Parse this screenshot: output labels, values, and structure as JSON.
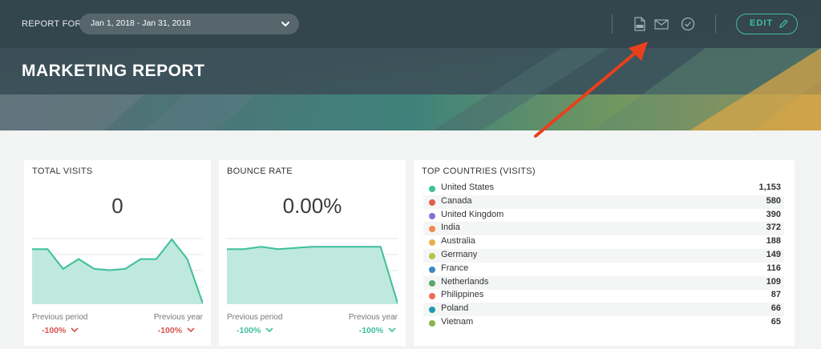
{
  "header": {
    "report_for_label": "REPORT FOR",
    "date_range": "Jan 1, 2018 - Jan 31, 2018",
    "title": "MARKETING REPORT",
    "edit_label": "EDIT",
    "icons": [
      "pdf-icon",
      "email-icon",
      "check-circle-icon",
      "pencil-icon",
      "chevron-down-icon"
    ]
  },
  "colors": {
    "accent": "#3dbf9c",
    "negative": "#d9534f",
    "annotation_arrow": "#e8401c"
  },
  "total_visits": {
    "title": "TOTAL VISITS",
    "value": "0",
    "prev_period_label": "Previous period",
    "prev_period_value": "-100%",
    "prev_year_label": "Previous year",
    "prev_year_value": "-100%",
    "sparkline": [
      10,
      10,
      2,
      6,
      2,
      1.5,
      2,
      6,
      6,
      14,
      6,
      -12
    ]
  },
  "bounce_rate": {
    "title": "BOUNCE RATE",
    "value": "0.00%",
    "prev_period_label": "Previous period",
    "prev_period_value": "-100%",
    "prev_year_label": "Previous year",
    "prev_year_value": "-100%",
    "sparkline": [
      10,
      10,
      11,
      10,
      10.5,
      11,
      11,
      11,
      11,
      11,
      -12
    ]
  },
  "top_countries": {
    "title": "TOP COUNTRIES (VISITS)",
    "rows": [
      {
        "name": "United States",
        "value": "1,153",
        "color": "#3dbf9c"
      },
      {
        "name": "Canada",
        "value": "580",
        "color": "#e35d4f"
      },
      {
        "name": "United Kingdom",
        "value": "390",
        "color": "#8e6bd6"
      },
      {
        "name": "India",
        "value": "372",
        "color": "#ef8a4c"
      },
      {
        "name": "Australia",
        "value": "188",
        "color": "#e8b04a"
      },
      {
        "name": "Germany",
        "value": "149",
        "color": "#b7c24a"
      },
      {
        "name": "France",
        "value": "116",
        "color": "#3a86c8"
      },
      {
        "name": "Netherlands",
        "value": "109",
        "color": "#5aa86a"
      },
      {
        "name": "Philippines",
        "value": "87",
        "color": "#ee6c55"
      },
      {
        "name": "Poland",
        "value": "66",
        "color": "#1e9bb3"
      },
      {
        "name": "Vietnam",
        "value": "65",
        "color": "#86b54a"
      }
    ]
  }
}
